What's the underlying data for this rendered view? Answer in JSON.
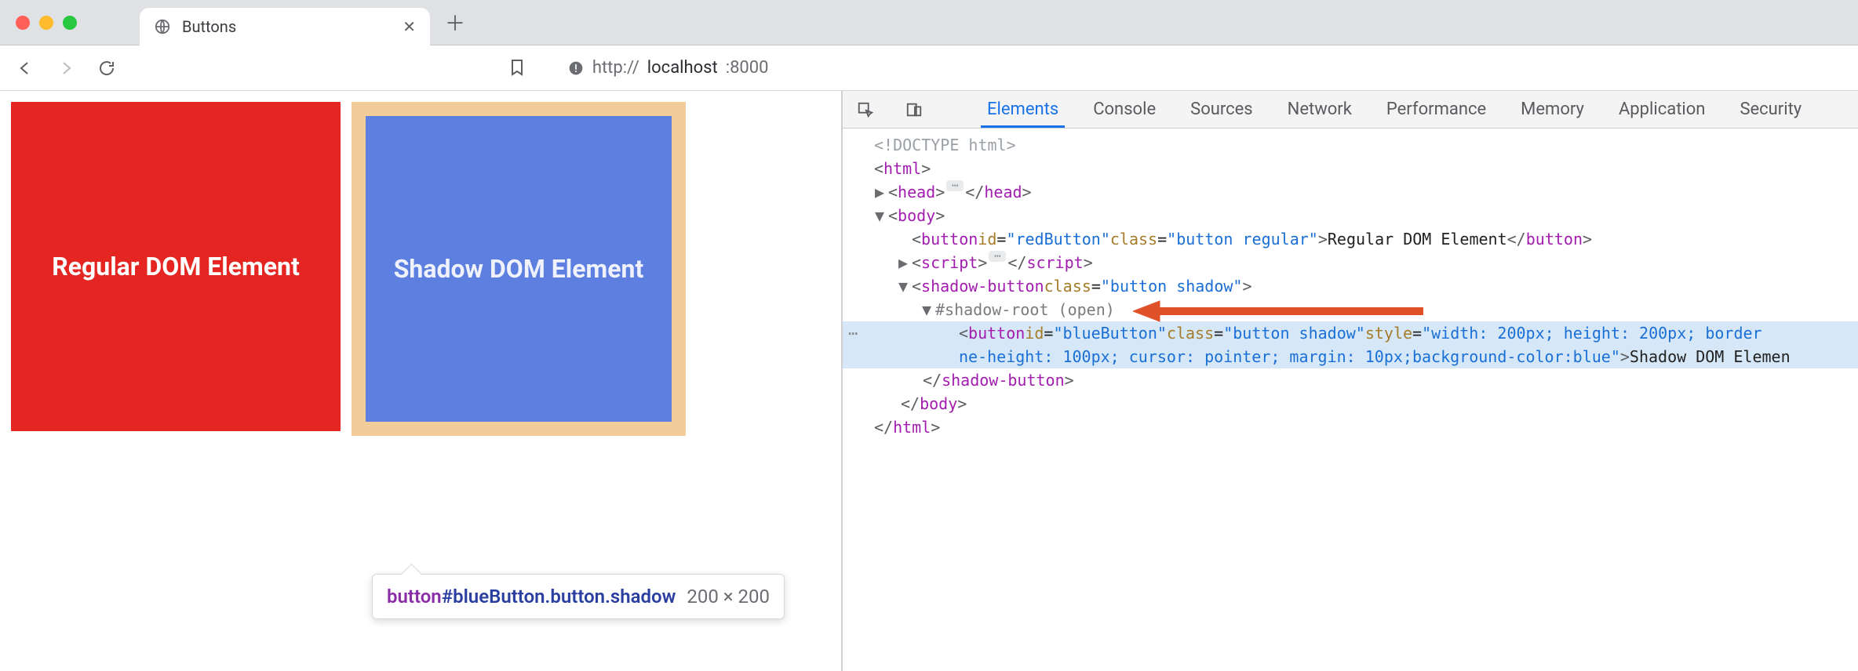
{
  "window": {
    "tab_title": "Buttons",
    "url_scheme": "http://",
    "url_host": "localhost",
    "url_portpath": ":8000"
  },
  "page": {
    "button_a_label": "Regular DOM Element",
    "button_b_label": "Shadow DOM Element",
    "tooltip_tag": "button",
    "tooltip_selector": "#blueButton.button.shadow",
    "tooltip_dims": "200 × 200"
  },
  "devtools": {
    "tabs": [
      "Elements",
      "Console",
      "Sources",
      "Network",
      "Performance",
      "Memory",
      "Application",
      "Security"
    ],
    "active_tab_index": 0,
    "dom_lines": {
      "l0": "<!DOCTYPE html>",
      "l1_open": "<html>",
      "l1_close": "</html>",
      "head_open": "<head>",
      "head_close": "</head>",
      "body_open": "<body>",
      "body_close": "</body>",
      "red_button_open": "<button ",
      "red_button_id_n": "id",
      "red_button_id_v": "\"redButton\"",
      "red_button_class_n": "class",
      "red_button_class_v": "\"button regular\"",
      "red_button_text": "Regular DOM Element",
      "red_button_close": "</button>",
      "script_open": "<script>",
      "script_close": "</script>",
      "shadow_open": "<shadow-button ",
      "shadow_class_n": "class",
      "shadow_class_v": "\"button shadow\"",
      "shadow_close": "</shadow-button>",
      "shadow_root": "#shadow-root (open)",
      "blue_line1": "<button id=\"blueButton\" class=\"button shadow\" style=\"width: 200px; height: 200px; border",
      "blue_line2": "ne-height: 100px; cursor: pointer; margin: 10px;background-color:blue\">Shadow DOM Elemen",
      "blue_id_n": "id",
      "blue_id_v": "\"blueButton\"",
      "blue_class_n": "class",
      "blue_class_v": "\"button shadow\"",
      "blue_style_n": "style",
      "blue_style_v1": "\"width: 200px; height: 200px; border",
      "blue_style_v2": "ne-height: 100px; cursor: pointer; margin: 10px;background-color:blue\"",
      "blue_text_frag": "Shadow DOM Elemen"
    }
  }
}
